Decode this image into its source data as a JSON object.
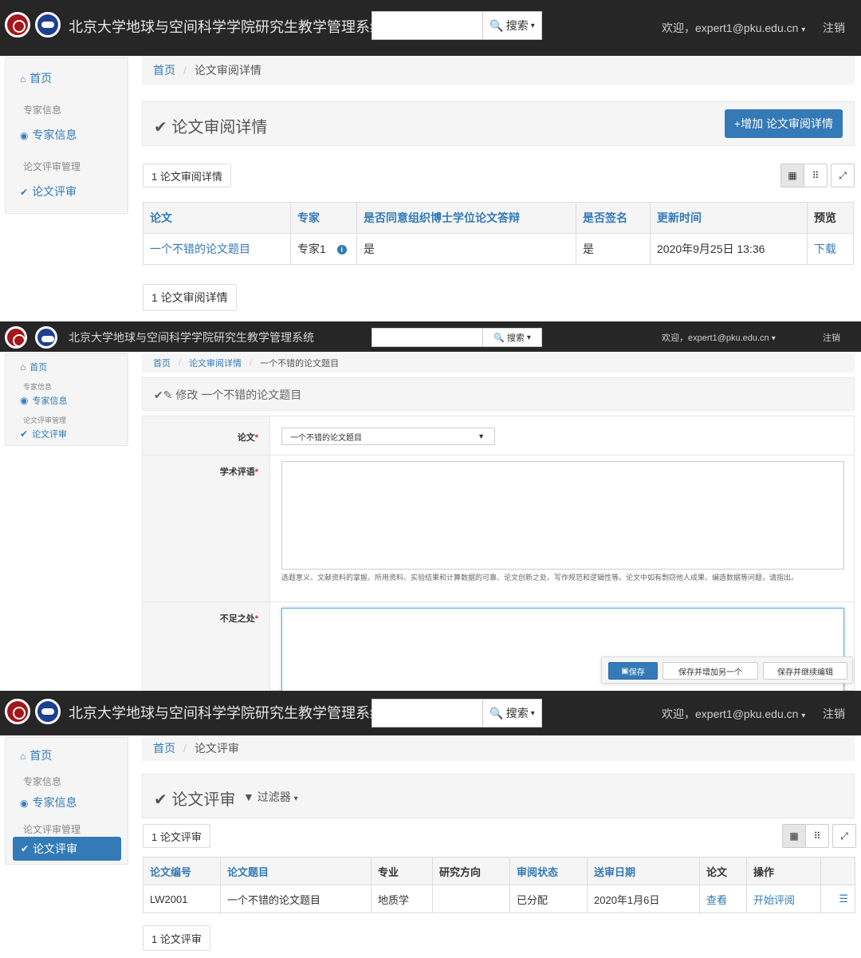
{
  "app": {
    "brand": "北京大学地球与空间科学学院研究生教学管理系统",
    "search_label": "搜索",
    "welcome": "欢迎，expert1@pku.edu.cn",
    "logout": "注销"
  },
  "sidebar": {
    "home": "首页",
    "expert_header": "专家信息",
    "expert_item": "专家信息",
    "review_header": "论文评审管理",
    "review_item": "论文评审"
  },
  "panel1": {
    "breadcrumb": {
      "home": "首页",
      "current": "论文审阅详情"
    },
    "title": "论文审阅详情",
    "add_button": "增加 论文审阅详情",
    "count_top": "1 论文审阅详情",
    "count_bottom": "1 论文审阅详情",
    "columns": [
      "论文",
      "专家",
      "是否同意组织博士学位论文答辩",
      "是否签名",
      "更新时间",
      "预览"
    ],
    "rows": [
      {
        "thesis": "一个不错的论文题目",
        "expert": "专家1",
        "agree": "是",
        "signed": "是",
        "updated": "2020年9月25日 13:36",
        "preview": "下载"
      }
    ]
  },
  "panel2": {
    "breadcrumb": {
      "home": "首页",
      "mid": "论文审阅详情",
      "current": "一个不错的论文题目"
    },
    "title": "修改 一个不错的论文题目",
    "field_thesis_label": "论文",
    "field_thesis_value": "一个不错的论文题目",
    "field_comment_label": "学术评语",
    "field_comment_help": "选题意义、文献资料的掌握、所用资料、实验结果和计算数据的可靠、论文创新之处、写作规范和逻辑性等。论文中如有剽窃他人成果、编造数据等问题，请指出。",
    "field_weakness_label": "不足之处",
    "required_mark": "*",
    "save": "保存",
    "save_add": "保存并增加另一个",
    "save_continue": "保存并继续编辑"
  },
  "panel3": {
    "breadcrumb": {
      "home": "首页",
      "current": "论文评审"
    },
    "title": "论文评审",
    "filter": "过滤器",
    "count_top": "1 论文评审",
    "count_bottom": "1 论文评审",
    "columns": [
      "论文编号",
      "论文题目",
      "专业",
      "研究方向",
      "审阅状态",
      "送审日期",
      "论文",
      "操作"
    ],
    "rows": [
      {
        "id": "LW2001",
        "title": "一个不错的论文题目",
        "major": "地质学",
        "direction": "",
        "status": "已分配",
        "date": "2020年1月6日",
        "view": "查看",
        "action": "开始评阅"
      }
    ]
  },
  "colors": {
    "navbar": "#262626",
    "link": "#337ab7",
    "panel_bg": "#f5f5f5"
  }
}
